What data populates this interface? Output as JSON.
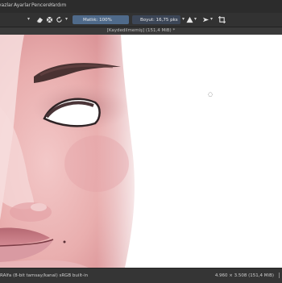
{
  "menu": {
    "items": [
      "yazlar",
      "Ayarlar",
      "Pencere",
      "Yardım"
    ]
  },
  "toolbar": {
    "opacity_label": "Matlık: 100%",
    "opacity_value": 1.0,
    "size_label": "Boyut: 16,75 pks",
    "icons": [
      "eraser-icon",
      "pattern-icon",
      "reset-icon",
      "chevron-down-icon",
      "warning-icon",
      "arrow-icon",
      "crop-icon"
    ]
  },
  "document": {
    "tab_title": "[Kaydedilmemiş]  (151,4 MiB) *"
  },
  "status": {
    "left": "RAlfa (8-bit tamsay/kanal) sRGB built-in",
    "right": "4.960 × 3.508 (151,4 MiB)"
  },
  "colors": {
    "menubar": "#2c2c2c",
    "toolbar": "#323232",
    "slider_fill": "#4f6a8a",
    "canvas": "#ffffff",
    "statusbar": "#353535"
  }
}
